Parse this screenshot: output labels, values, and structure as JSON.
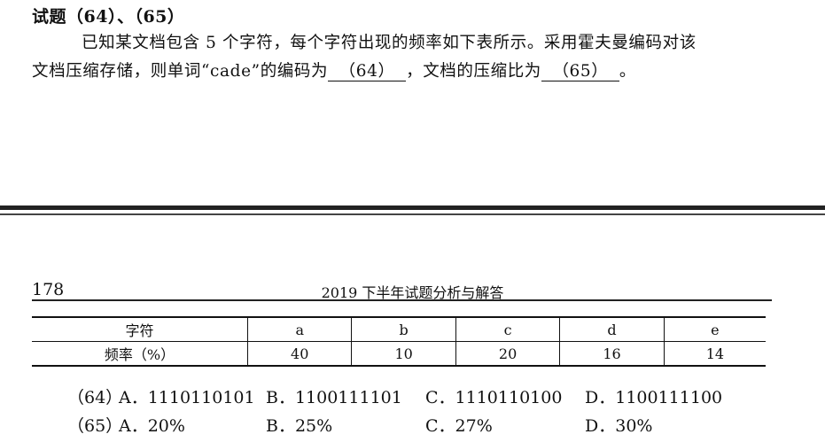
{
  "question": {
    "title": "试题（64）、（65）",
    "line1": "已知某文档包含 5 个字符，每个字符出现的频率如下表所示。采用霍夫曼编码对该",
    "line2_a": "文档压缩存储，则单词“cade”的编码为",
    "blank64": "（64）",
    "line2_b": "，文档的压缩比为",
    "blank65": "（65）",
    "line2_c": "。"
  },
  "page": {
    "number": "178",
    "header": "2019 下半年试题分析与解答"
  },
  "table": {
    "row1_label": "字符",
    "row2_label": "频率（%）",
    "chars": [
      "a",
      "b",
      "c",
      "d",
      "e"
    ],
    "freqs": [
      "40",
      "10",
      "20",
      "16",
      "14"
    ]
  },
  "options": {
    "q64": {
      "label": "（64）",
      "A": "A．1110110101",
      "B": "B．1100111101",
      "C": "C．1110110100",
      "D": "D．1100111100"
    },
    "q65": {
      "label": "（65）",
      "A": "A．20%",
      "B": "B．25%",
      "C": "C．27%",
      "D": "D．30%"
    }
  }
}
